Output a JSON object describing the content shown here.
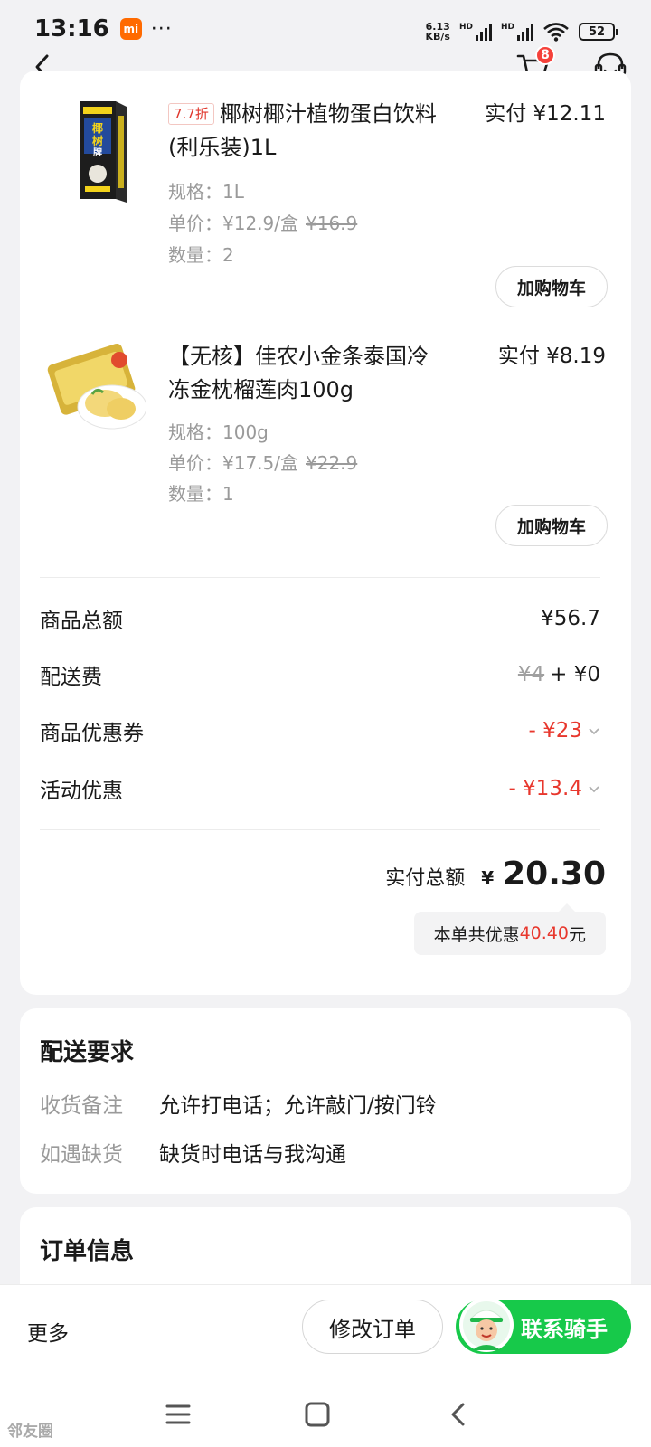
{
  "status_bar": {
    "time": "13:16",
    "mi_label": "mi",
    "more_dots": "···",
    "net_speed_value": "6.13",
    "net_speed_unit": "KB/s",
    "hd_label": "HD",
    "battery": "52"
  },
  "nav": {
    "cart_count": "8"
  },
  "products": [
    {
      "discount_tag": "7.7折",
      "name": "椰树椰汁植物蛋白饮料(利乐装)1L",
      "paid_price": "实付 ¥12.11",
      "spec": "规格：1L",
      "unit_price": "单价：¥12.9/盒",
      "original_price": "¥16.9",
      "quantity": "数量：2",
      "add_to_cart": "加购物车"
    },
    {
      "name": "【无核】佳农小金条泰国冷冻金枕榴莲肉100g",
      "paid_price": "实付 ¥8.19",
      "spec": "规格：100g",
      "unit_price": "单价：¥17.5/盒",
      "original_price": "¥22.9",
      "quantity": "数量：1",
      "add_to_cart": "加购物车"
    }
  ],
  "summary": {
    "goods_total_label": "商品总额",
    "goods_total_value": "¥56.7",
    "delivery_label": "配送费",
    "delivery_original": "¥4",
    "delivery_value": "+ ¥0",
    "coupon_label": "商品优惠券",
    "coupon_value": "- ¥23",
    "activity_label": "活动优惠",
    "activity_value": "- ¥13.4",
    "total_label": "实付总额",
    "total_currency": "¥",
    "total_amount": "20.30",
    "saving_prefix": "本单共优惠",
    "saving_amount": "40.40",
    "saving_suffix": "元"
  },
  "delivery_requirements": {
    "title": "配送要求",
    "remark_label": "收货备注",
    "remark_value": "允许打电话；允许敲门/按门铃",
    "shortage_label": "如遇缺货",
    "shortage_value": "缺货时电话与我沟通"
  },
  "order_info": {
    "title": "订单信息"
  },
  "bottom_bar": {
    "more": "更多",
    "modify_order": "修改订单",
    "contact_rider": "联系骑手"
  },
  "watermark": "邻友圈",
  "colors": {
    "accent_green": "#17c94a",
    "discount_red": "#e8372d",
    "badge_red": "#f5413a"
  }
}
